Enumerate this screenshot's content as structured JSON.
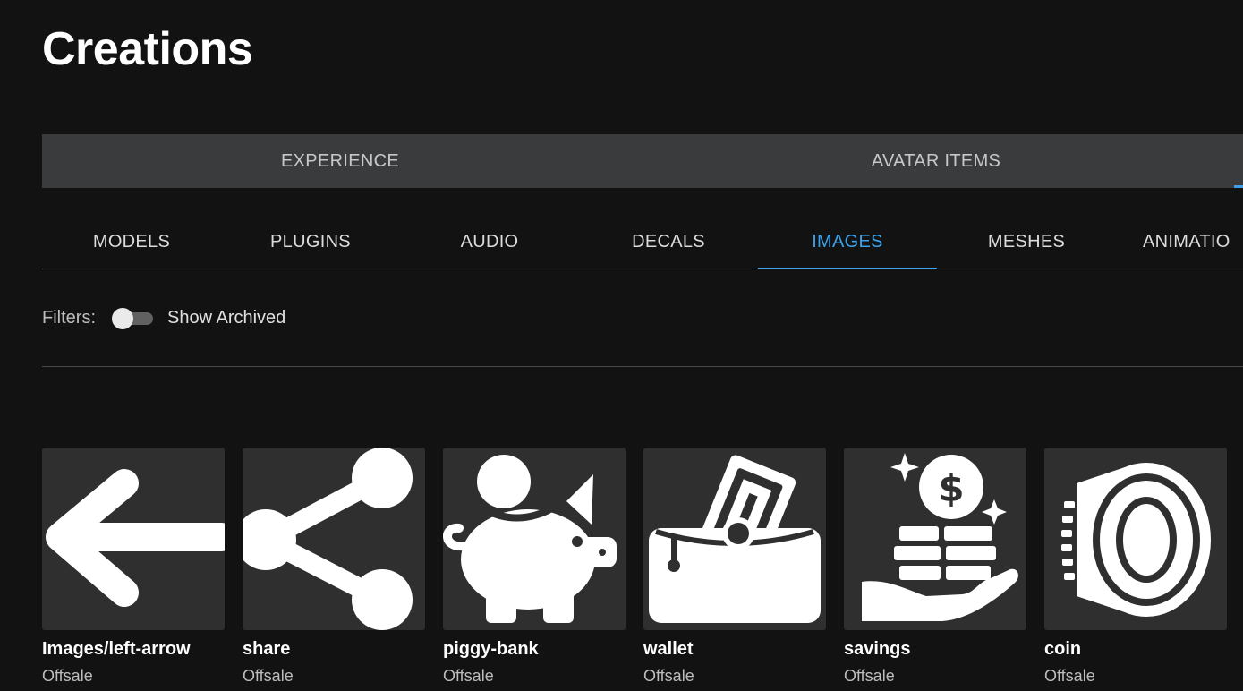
{
  "page": {
    "title": "Creations"
  },
  "category_tabs": [
    {
      "label": "EXPERIENCE"
    },
    {
      "label": "AVATAR ITEMS"
    }
  ],
  "asset_tabs": [
    {
      "label": "MODELS"
    },
    {
      "label": "PLUGINS"
    },
    {
      "label": "AUDIO"
    },
    {
      "label": "DECALS"
    },
    {
      "label": "IMAGES",
      "active": true
    },
    {
      "label": "MESHES"
    },
    {
      "label": "ANIMATIO"
    }
  ],
  "filters": {
    "label": "Filters:",
    "show_archived_label": "Show Archived",
    "show_archived_on": false
  },
  "items": [
    {
      "name": "Images/left-arrow",
      "status": "Offsale",
      "icon": "left-arrow-icon"
    },
    {
      "name": "share",
      "status": "Offsale",
      "icon": "share-icon"
    },
    {
      "name": "piggy-bank",
      "status": "Offsale",
      "icon": "piggy-bank-icon"
    },
    {
      "name": "wallet",
      "status": "Offsale",
      "icon": "wallet-icon"
    },
    {
      "name": "savings",
      "status": "Offsale",
      "icon": "savings-icon"
    },
    {
      "name": "coin",
      "status": "Offsale",
      "icon": "coin-icon"
    }
  ],
  "colors": {
    "background": "#121212",
    "tab_bar": "#393b3d",
    "accent": "#3ea2e8",
    "thumbnail": "#2f2f2f"
  }
}
